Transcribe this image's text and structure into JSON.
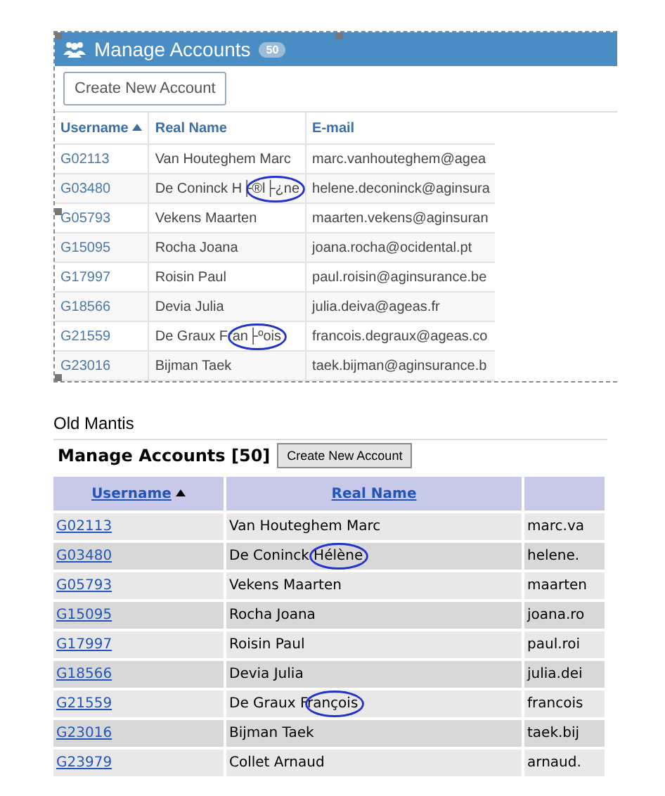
{
  "new_ui": {
    "title": "Manage Accounts",
    "count": "50",
    "button": "Create New Account",
    "columns": [
      {
        "label": "Username",
        "sort_ascending": true
      },
      {
        "label": "Real Name",
        "sort_ascending": false
      },
      {
        "label": "E-mail",
        "sort_ascending": false
      }
    ],
    "rows": [
      {
        "username": "G02113",
        "real_name": "Van Houteghem Marc",
        "email": "marc.vanhouteghem@agea",
        "annotated": false
      },
      {
        "username": "G03480",
        "real_name": "De Coninck H├®l├¿ne",
        "email": "helene.deconinck@aginsura",
        "annotated": true
      },
      {
        "username": "G05793",
        "real_name": "Vekens Maarten",
        "email": "maarten.vekens@aginsuran",
        "annotated": false
      },
      {
        "username": "G15095",
        "real_name": "Rocha Joana",
        "email": "joana.rocha@ocidental.pt",
        "annotated": false
      },
      {
        "username": "G17997",
        "real_name": "Roisin Paul",
        "email": "paul.roisin@aginsurance.be",
        "annotated": false
      },
      {
        "username": "G18566",
        "real_name": "Devia Julia",
        "email": "julia.deiva@ageas.fr",
        "annotated": false
      },
      {
        "username": "G21559",
        "real_name": "De Graux Fran├ºois",
        "email": "francois.degraux@ageas.co",
        "annotated": true
      },
      {
        "username": "G23016",
        "real_name": "Bijman Taek",
        "email": "taek.bijman@aginsurance.b",
        "annotated": false
      }
    ]
  },
  "old_section": {
    "label": "Old Mantis",
    "title": "Manage Accounts [50]",
    "button": "Create New Account",
    "columns": [
      {
        "label": "Username",
        "sort_ascending": true
      },
      {
        "label": "Real Name",
        "sort_ascending": false
      }
    ],
    "rows": [
      {
        "username": "G02113",
        "real_name": "Van Houteghem Marc",
        "email": "marc.va",
        "annotated": false
      },
      {
        "username": "G03480",
        "real_name": "De Coninck Hélène",
        "email": "helene.",
        "annotated": true
      },
      {
        "username": "G05793",
        "real_name": "Vekens Maarten",
        "email": "maarten",
        "annotated": false
      },
      {
        "username": "G15095",
        "real_name": "Rocha Joana",
        "email": "joana.ro",
        "annotated": false
      },
      {
        "username": "G17997",
        "real_name": "Roisin Paul",
        "email": "paul.roi",
        "annotated": false
      },
      {
        "username": "G18566",
        "real_name": "Devia Julia",
        "email": "julia.dei",
        "annotated": false
      },
      {
        "username": "G21559",
        "real_name": "De Graux François",
        "email": "francois",
        "annotated": true
      },
      {
        "username": "G23016",
        "real_name": "Bijman Taek",
        "email": "taek.bij",
        "annotated": false
      },
      {
        "username": "G23979",
        "real_name": "Collet Arnaud",
        "email": "arnaud.",
        "annotated": false
      }
    ]
  }
}
